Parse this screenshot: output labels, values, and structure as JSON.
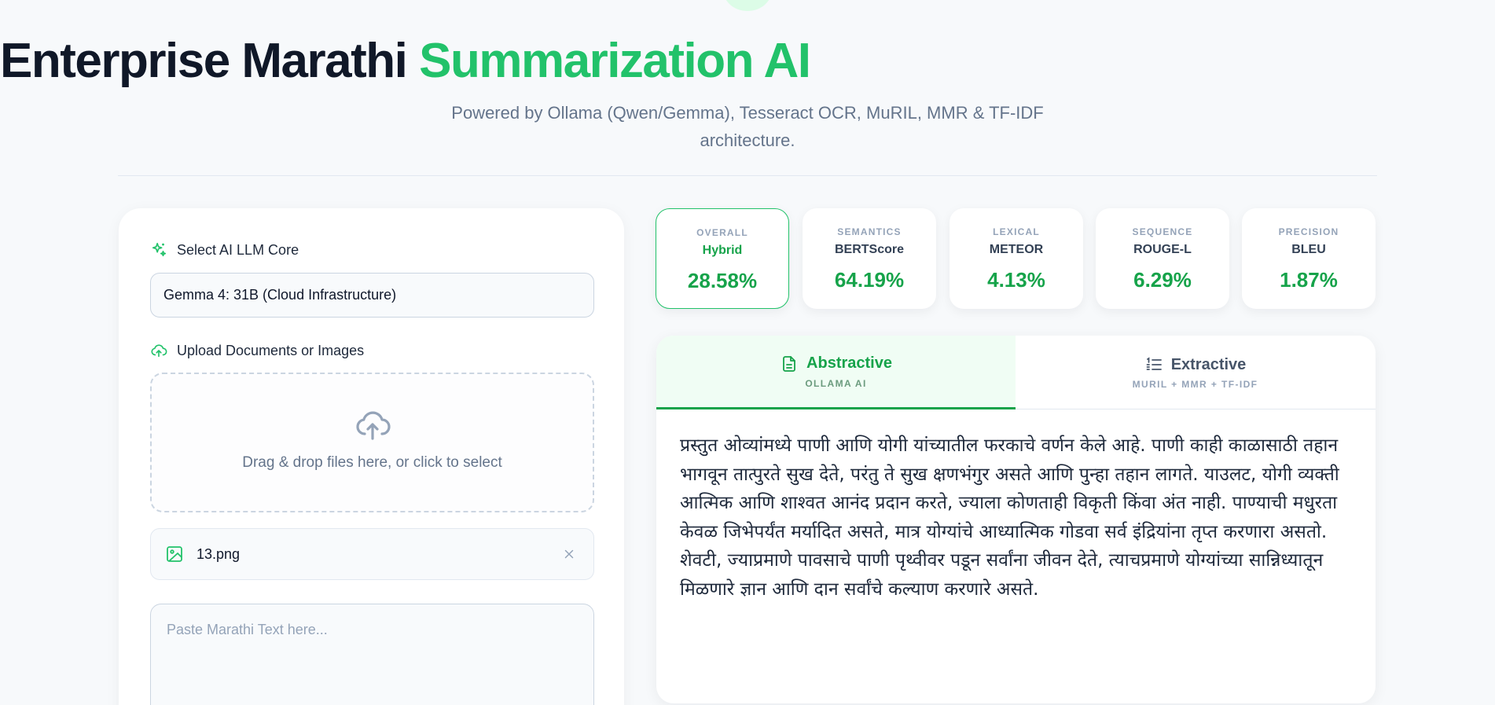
{
  "header": {
    "title_main": "Enterprise Marathi ",
    "title_accent": "Summarization AI",
    "subtitle": "Powered by Ollama (Qwen/Gemma), Tesseract OCR, MuRIL, MMR & TF-IDF architecture."
  },
  "controls": {
    "model_label": "Select AI LLM Core",
    "model_value": "Gemma 4: 31B (Cloud Infrastructure)",
    "upload_label": "Upload Documents or Images",
    "dropzone_text": "Drag & drop files here, or click to select",
    "file_name": "13.png",
    "text_placeholder": "Paste Marathi Text here..."
  },
  "metrics": [
    {
      "category": "OVERALL",
      "name": "Hybrid",
      "value": "28.58%"
    },
    {
      "category": "SEMANTICS",
      "name": "BERTScore",
      "value": "64.19%"
    },
    {
      "category": "LEXICAL",
      "name": "METEOR",
      "value": "4.13%"
    },
    {
      "category": "SEQUENCE",
      "name": "ROUGE-L",
      "value": "6.29%"
    },
    {
      "category": "PRECISION",
      "name": "BLEU",
      "value": "1.87%"
    }
  ],
  "tabs": [
    {
      "title": "Abstractive",
      "subtitle": "OLLAMA AI",
      "active": true
    },
    {
      "title": "Extractive",
      "subtitle": "MURIL + MMR + TF-IDF",
      "active": false
    }
  ],
  "summary": "प्रस्तुत ओव्यांमध्ये पाणी आणि योगी यांच्यातील फरकाचे वर्णन केले आहे. पाणी काही काळासाठी तहान भागवून तात्पुरते सुख देते, परंतु ते सुख क्षणभंगुर असते आणि पुन्हा तहान लागते. याउलट, योगी व्यक्ती आत्मिक आणि शाश्वत आनंद प्रदान करते, ज्याला कोणताही विकृती किंवा अंत नाही. पाण्याची मधुरता केवळ जिभेपर्यंत मर्यादित असते, मात्र योग्यांचे आध्यात्मिक गोडवा सर्व इंद्रियांना तृप्त करणारा असतो. शेवटी, ज्याप्रमाणे पावसाचे पाणी पृथ्वीवर पडून सर्वांना जीवन देते, त्याचप्रमाणे योग्यांच्या सान्निध्यातून मिळणारे ज्ञान आणि दान सर्वांचे कल्याण करणारे असते.",
  "colors": {
    "accent": "#22c26a",
    "accent_dark": "#16a34a",
    "background": "#f7f9fb"
  }
}
